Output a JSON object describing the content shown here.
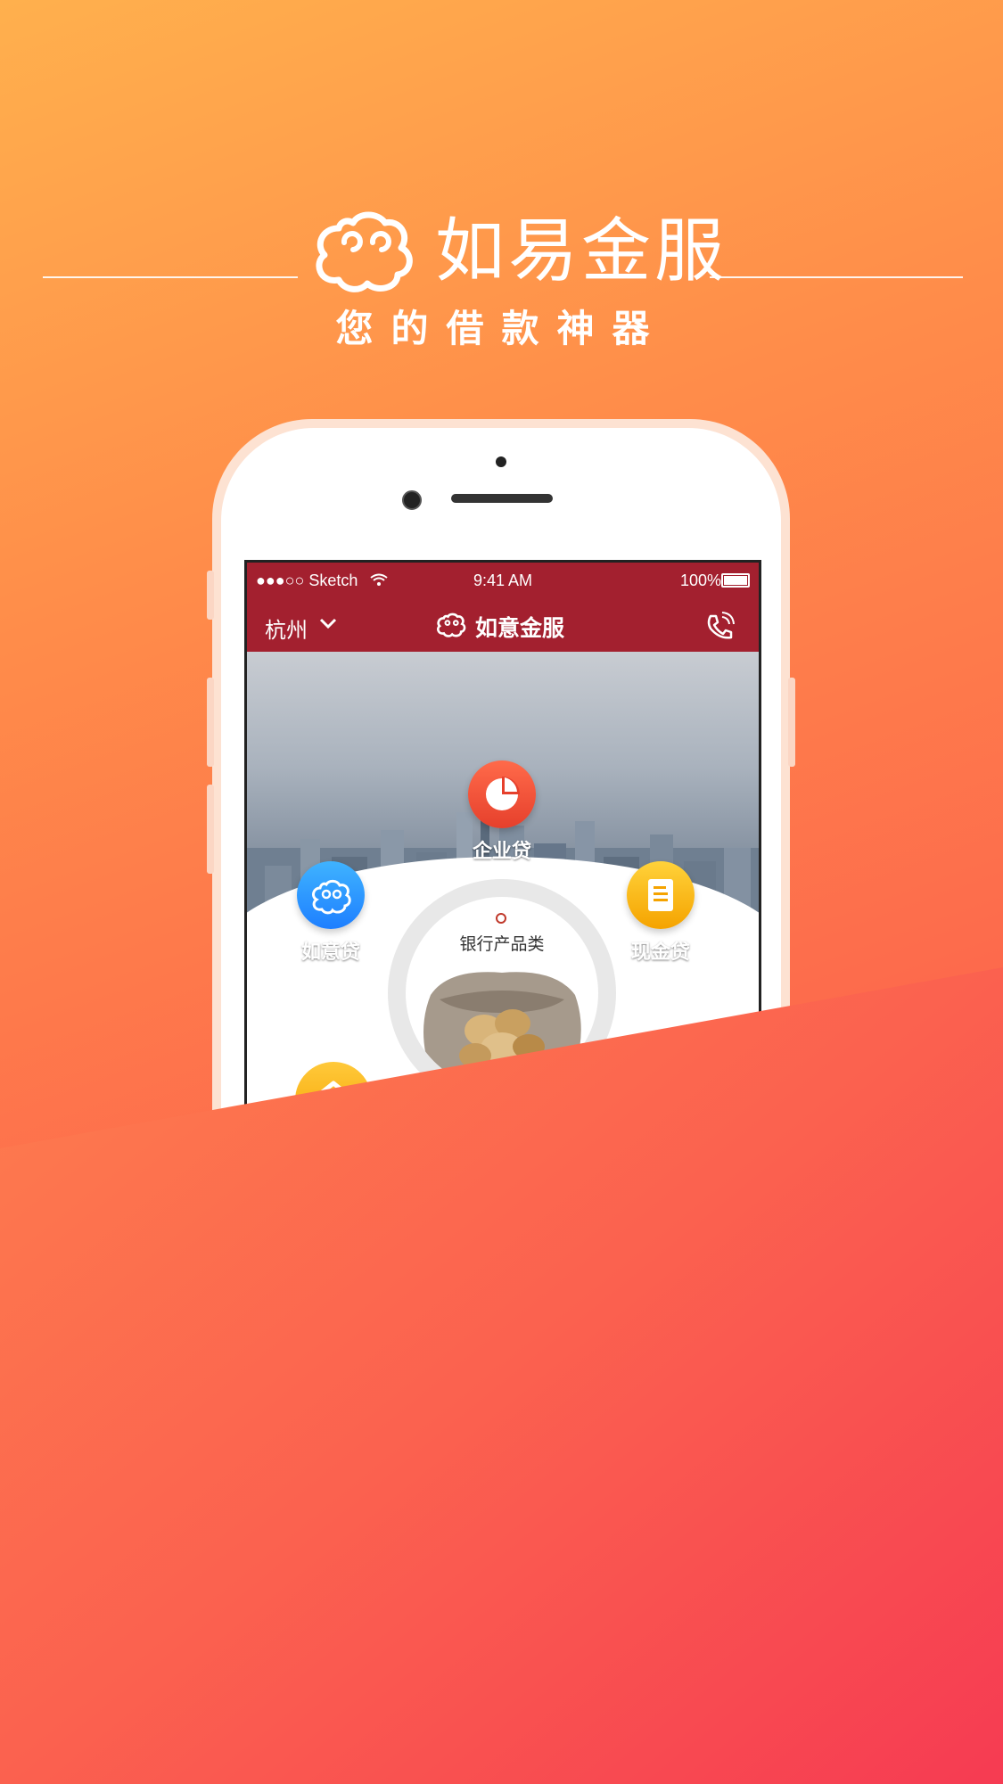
{
  "hero": {
    "brand_title": "如易金服",
    "subtitle": "您的借款神器"
  },
  "status_bar": {
    "carrier": "●●●○○ Sketch",
    "time": "9:41 AM",
    "battery": "100%"
  },
  "nav": {
    "city": "杭州",
    "title": "如意金服"
  },
  "menu": {
    "items": [
      {
        "label": "企业贷",
        "icon": "pie-chart-icon"
      },
      {
        "label": "如意贷",
        "icon": "cloud-icon"
      },
      {
        "label": "现金贷",
        "icon": "document-icon"
      }
    ],
    "center_label": "银行产品类"
  },
  "colors": {
    "nav_red": "#a3202f",
    "gradient_top": "#ffb04d",
    "gradient_bottom": "#f73a52"
  }
}
